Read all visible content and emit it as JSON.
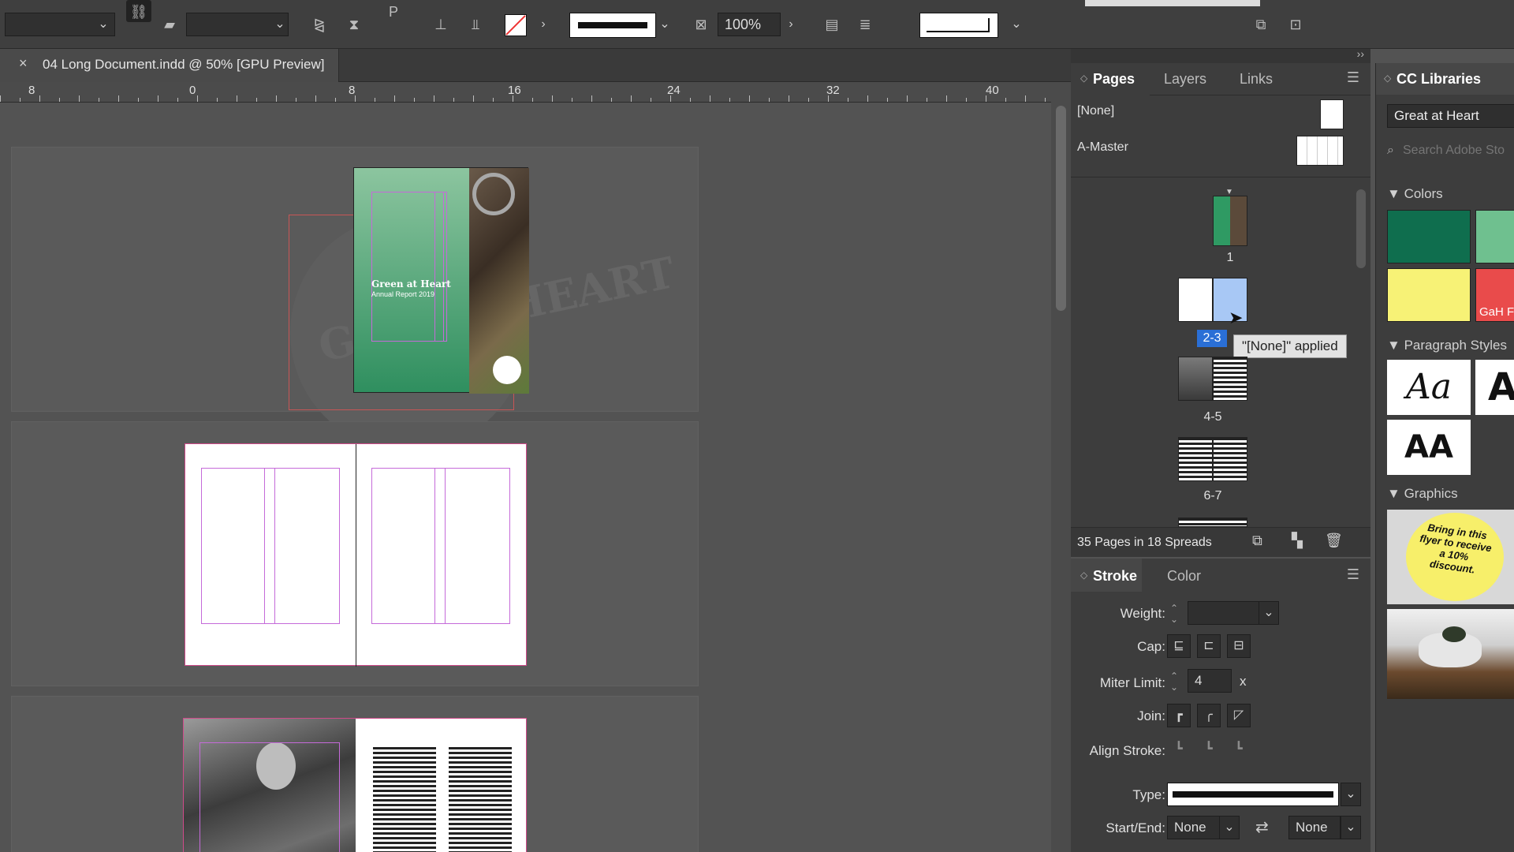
{
  "control_bar": {
    "zoom_value": "100%",
    "link_icon": "chain-link-icon"
  },
  "document_tab": {
    "close_label": "×",
    "title": "04 Long Document.indd @ 50% [GPU Preview]"
  },
  "ruler": {
    "labels": [
      "8",
      "0",
      "8",
      "16",
      "24",
      "32",
      "40"
    ]
  },
  "canvas": {
    "cover_title": "Green at Heart",
    "cover_subtitle": "Annual Report 2019",
    "watermark_text": "GREEN HEART"
  },
  "pages_panel": {
    "tabs": [
      "Pages",
      "Layers",
      "Links"
    ],
    "masters": [
      "[None]",
      "A-Master"
    ],
    "page_labels": [
      "1",
      "2-3",
      "4-5",
      "6-7"
    ],
    "tooltip": "\"[None]\" applied",
    "footer_text": "35 Pages in 18 Spreads"
  },
  "stroke_panel": {
    "tabs": [
      "Stroke",
      "Color"
    ],
    "weight_label": "Weight:",
    "weight_value": "",
    "cap_label": "Cap:",
    "miter_label": "Miter Limit:",
    "miter_value": "4",
    "miter_unit": "x",
    "join_label": "Join:",
    "align_label": "Align Stroke:",
    "type_label": "Type:",
    "startend_label": "Start/End:",
    "start_value": "None",
    "end_value": "None"
  },
  "cc_libraries": {
    "title": "CC Libraries",
    "library_name": "Great at Heart",
    "search_placeholder": "Search Adobe Sto",
    "sections": {
      "colors": "Colors",
      "paragraph_styles": "Paragraph Styles",
      "graphics": "Graphics"
    },
    "color_swatches": [
      "#0f6e4e",
      "#6fc08f",
      "#f7f276",
      "#e94b4b"
    ],
    "swatch_label": "GaH F",
    "style_samples": [
      "Aa",
      "A",
      "AA"
    ],
    "flyer_text": "Bring in this flyer to receive a 10% discount."
  }
}
